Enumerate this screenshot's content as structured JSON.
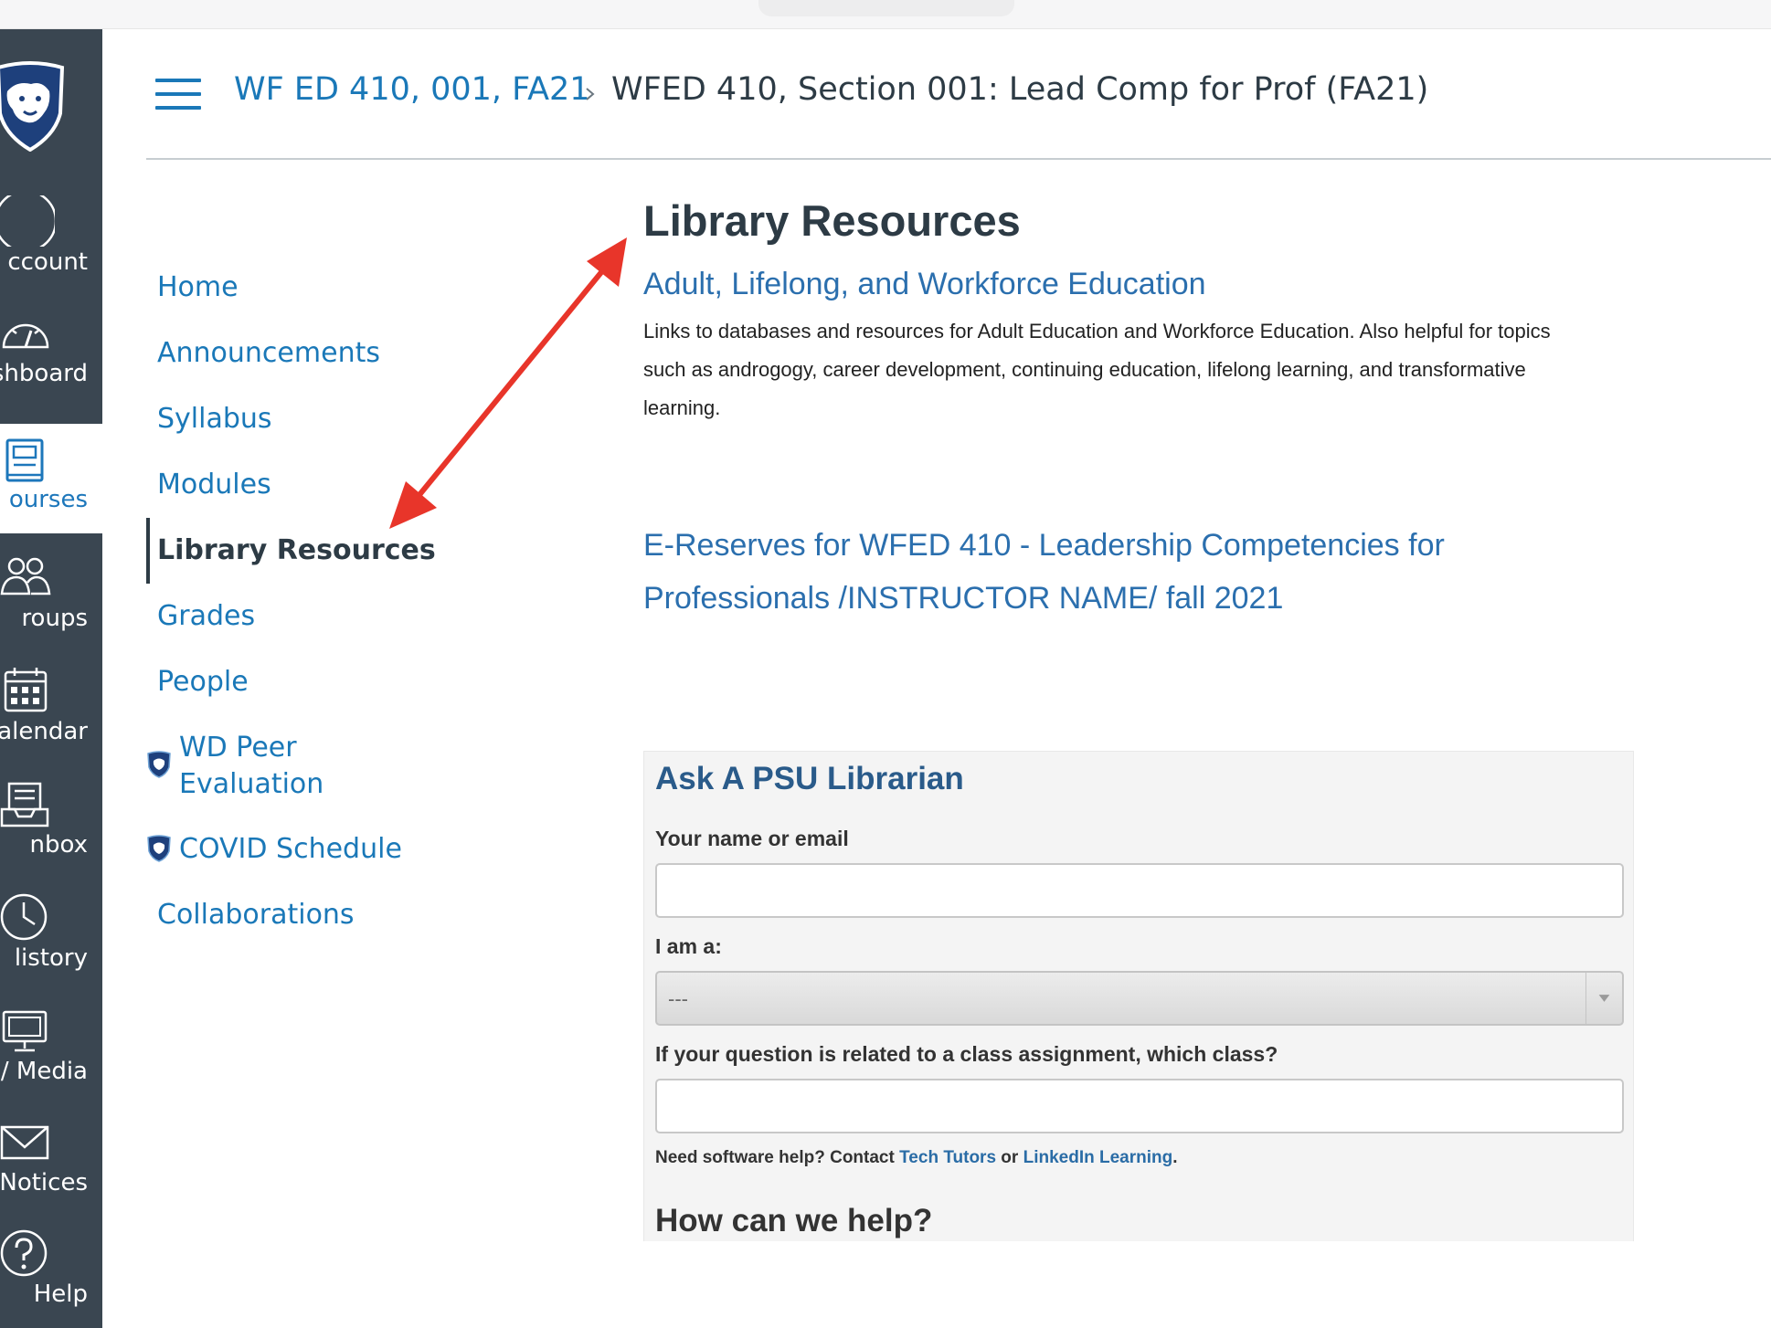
{
  "global_nav": {
    "items": [
      {
        "label": "ccount",
        "icon": "account-circle-icon"
      },
      {
        "label": "shboard",
        "icon": "dashboard-gauge-icon"
      },
      {
        "label": "ourses",
        "icon": "courses-book-icon"
      },
      {
        "label": "roups",
        "icon": "groups-people-icon"
      },
      {
        "label": "alendar",
        "icon": "calendar-icon"
      },
      {
        "label": "nbox",
        "icon": "inbox-icon"
      },
      {
        "label": "listory",
        "icon": "history-clock-icon"
      },
      {
        "label": "/ Media",
        "icon": "media-monitor-icon"
      },
      {
        "label": "Notices",
        "icon": "notices-envelope-icon"
      },
      {
        "label": "Help",
        "icon": "help-question-icon"
      }
    ],
    "active_index": 2,
    "colors": {
      "bg": "#3a4651",
      "active_bg": "#ffffff",
      "active_fg": "#1d77bb"
    }
  },
  "header": {
    "breadcrumb_course": "WF ED 410, 001, FA21",
    "breadcrumb_current": "WFED 410, Section 001: Lead Comp for Prof (FA21)"
  },
  "course_nav": {
    "items": [
      {
        "label": "Home"
      },
      {
        "label": "Announcements"
      },
      {
        "label": "Syllabus"
      },
      {
        "label": "Modules"
      },
      {
        "label": "Library Resources"
      },
      {
        "label": "Grades"
      },
      {
        "label": "People"
      },
      {
        "label_line1": "WD Peer",
        "label_line2": "Evaluation"
      },
      {
        "label": "COVID Schedule"
      },
      {
        "label": "Collaborations"
      }
    ],
    "active": "Library Resources",
    "link_color": "#1a78b8"
  },
  "main": {
    "page_title": "Library Resources",
    "section_title": "Adult, Lifelong, and Workforce Education",
    "description": "Links to databases and resources for Adult Education and Workforce Education. Also helpful for topics such as androgogy, career development, continuing education, lifelong learning, and transformative learning.",
    "ereserves_line1": "E-Reserves for WFED 410 - Leadership Competencies for",
    "ereserves_line2": "Professionals /INSTRUCTOR NAME/ fall 2021"
  },
  "librarian_widget": {
    "title": "Ask A PSU Librarian",
    "name_label": "Your name or email",
    "name_value": "",
    "role_label": "I am a:",
    "role_selected": "---",
    "class_label": "If your question is related to a class assignment, which class?",
    "class_value": "",
    "note_prefix": "Need software help? Contact ",
    "note_link1": "Tech Tutors",
    "note_middle": " or ",
    "note_link2": "LinkedIn Learning",
    "note_suffix": ".",
    "help_heading": "How can we help?"
  },
  "annotation": {
    "arrow_color": "#e8352a"
  }
}
